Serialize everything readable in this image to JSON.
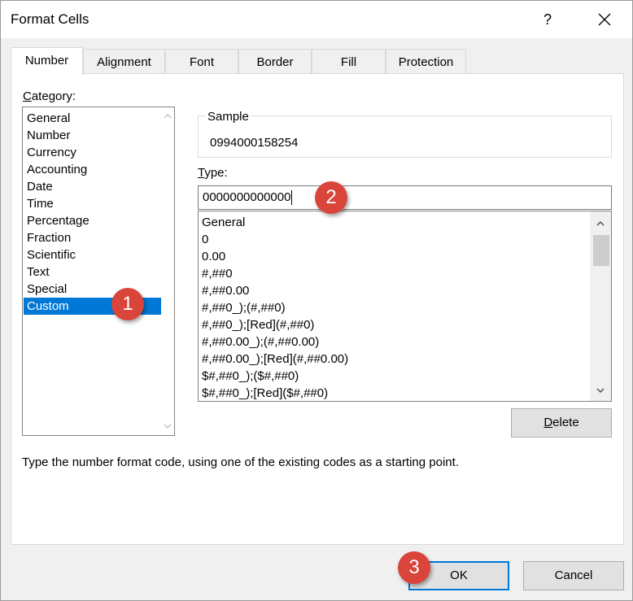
{
  "window": {
    "title": "Format Cells",
    "help_label": "?"
  },
  "tabs": [
    {
      "label": "Number",
      "active": true
    },
    {
      "label": "Alignment",
      "active": false
    },
    {
      "label": "Font",
      "active": false
    },
    {
      "label": "Border",
      "active": false
    },
    {
      "label": "Fill",
      "active": false
    },
    {
      "label": "Protection",
      "active": false
    }
  ],
  "category": {
    "label_first": "C",
    "label_rest": "ategory:",
    "items": [
      "General",
      "Number",
      "Currency",
      "Accounting",
      "Date",
      "Time",
      "Percentage",
      "Fraction",
      "Scientific",
      "Text",
      "Special",
      "Custom"
    ],
    "selected": "Custom"
  },
  "sample": {
    "label": "Sample",
    "value": "0994000158254"
  },
  "type": {
    "label_first": "T",
    "label_rest": "ype:",
    "value": "0000000000000"
  },
  "format_codes": [
    "General",
    "0",
    "0.00",
    "#,##0",
    "#,##0.00",
    "#,##0_);(#,##0)",
    "#,##0_);[Red](#,##0)",
    "#,##0.00_);(#,##0.00)",
    "#,##0.00_);[Red](#,##0.00)",
    "$#,##0_);($#,##0)",
    "$#,##0_);[Red]($#,##0)"
  ],
  "buttons": {
    "delete_first": "D",
    "delete_rest": "elete",
    "ok": "OK",
    "cancel": "Cancel"
  },
  "hint": "Type the number format code, using one of the existing codes as a starting point.",
  "badges": [
    "1",
    "2",
    "3"
  ],
  "colors": {
    "selection": "#0078d7",
    "badge": "#d9443b"
  }
}
